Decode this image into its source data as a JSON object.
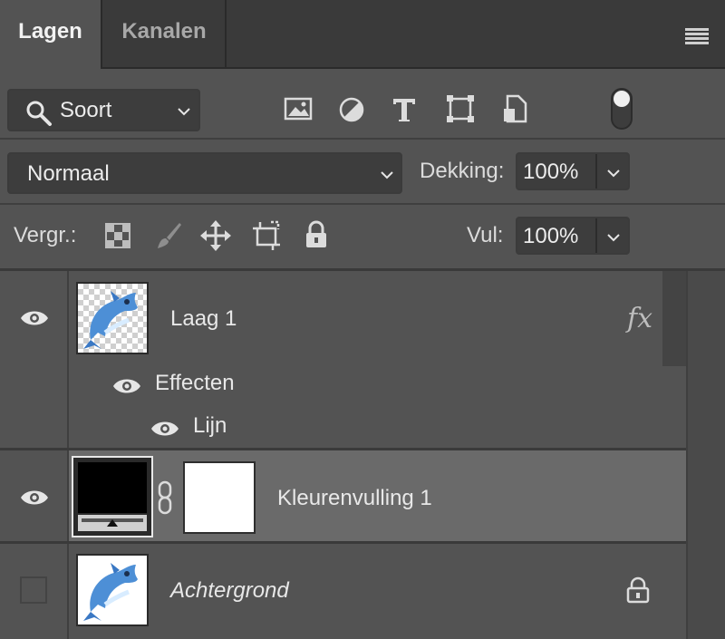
{
  "tabs": [
    {
      "label": "Lagen",
      "active": true
    },
    {
      "label": "Kanalen",
      "active": false
    }
  ],
  "filter": {
    "label": "Soort",
    "icons": [
      "image-filter-icon",
      "adjustment-filter-icon",
      "type-filter-icon",
      "shape-filter-icon",
      "smart-object-filter-icon"
    ],
    "toggle_on": true
  },
  "blend": {
    "mode": "Normaal",
    "opacity_label": "Dekking:",
    "opacity_value": "100%"
  },
  "lock": {
    "label": "Vergr.:",
    "icons": [
      "lock-transparency-icon",
      "lock-pixels-icon",
      "lock-position-icon",
      "lock-artboard-icon",
      "lock-all-icon"
    ],
    "fill_label": "Vul:",
    "fill_value": "100%"
  },
  "layers": [
    {
      "name": "Laag 1",
      "visible": true,
      "fx": "fx",
      "effects_label": "Effecten",
      "effect": "Lijn"
    },
    {
      "name": "Kleurenvulling 1",
      "visible": true,
      "selected": true
    },
    {
      "name": "Achtergrond",
      "visible": false,
      "locked": true
    }
  ],
  "colors": {
    "panel": "#535353",
    "tabbar": "#3a3a3a",
    "selected_row": "#6a6a6a",
    "field": "#3d3d3d"
  }
}
